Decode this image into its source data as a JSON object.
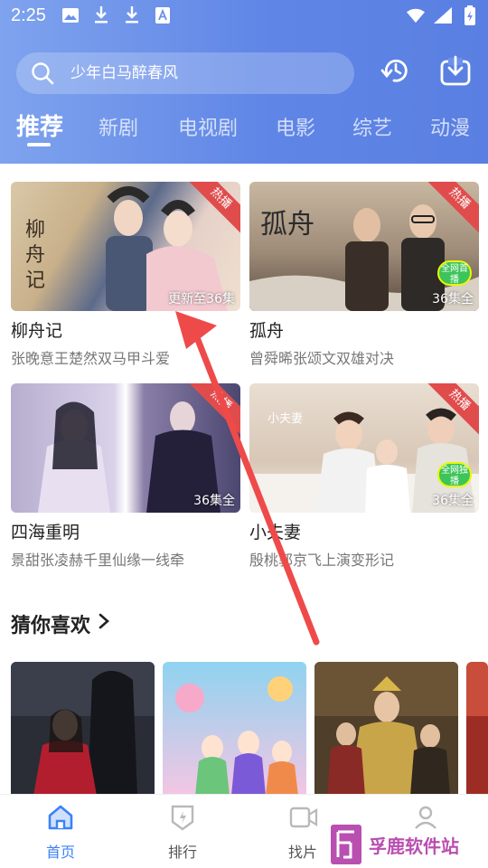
{
  "status": {
    "time": "2:25",
    "icons": [
      "image-icon",
      "download-icon",
      "download-icon",
      "font-icon"
    ],
    "right_icons": [
      "wifi-icon",
      "signal-icon",
      "battery-icon"
    ]
  },
  "search": {
    "placeholder": "少年白马醉春风"
  },
  "tabs": [
    {
      "label": "推荐",
      "active": true
    },
    {
      "label": "新剧"
    },
    {
      "label": "电视剧"
    },
    {
      "label": "电影"
    },
    {
      "label": "综艺"
    },
    {
      "label": "动漫"
    }
  ],
  "cards": [
    {
      "title": "柳舟记",
      "desc": "张晚意王楚然双马甲斗爱",
      "episode": "更新至36集",
      "ribbon": "热播",
      "poster_word": "柳舟记"
    },
    {
      "title": "孤舟",
      "desc": "曾舜晞张颂文双雄对决",
      "episode": "36集全",
      "ribbon": "热播",
      "badge": "全网首播",
      "poster_word": "孤舟"
    },
    {
      "title": "四海重明",
      "desc": "景甜张凌赫千里仙缘一线牵",
      "episode": "36集全",
      "ribbon": "热播"
    },
    {
      "title": "小夫妻",
      "desc": "殷桃郭京飞上演变形记",
      "episode": "36集全",
      "ribbon": "热播",
      "badge": "全网独播",
      "poster_word": "小夫妻"
    }
  ],
  "section": {
    "title": "猜你喜欢"
  },
  "nav": [
    {
      "label": "首页",
      "icon": "home-icon",
      "active": true
    },
    {
      "label": "排行",
      "icon": "ranking-icon"
    },
    {
      "label": "找片",
      "icon": "find-video-icon"
    },
    {
      "label": "",
      "icon": "user-icon"
    }
  ],
  "watermark": {
    "text": "孚鹿软件站"
  },
  "colors": {
    "accent": "#3b82f6",
    "header": "#6d91ea",
    "ribbon": "#e04c4c",
    "annotation": "#ef4a4a"
  }
}
